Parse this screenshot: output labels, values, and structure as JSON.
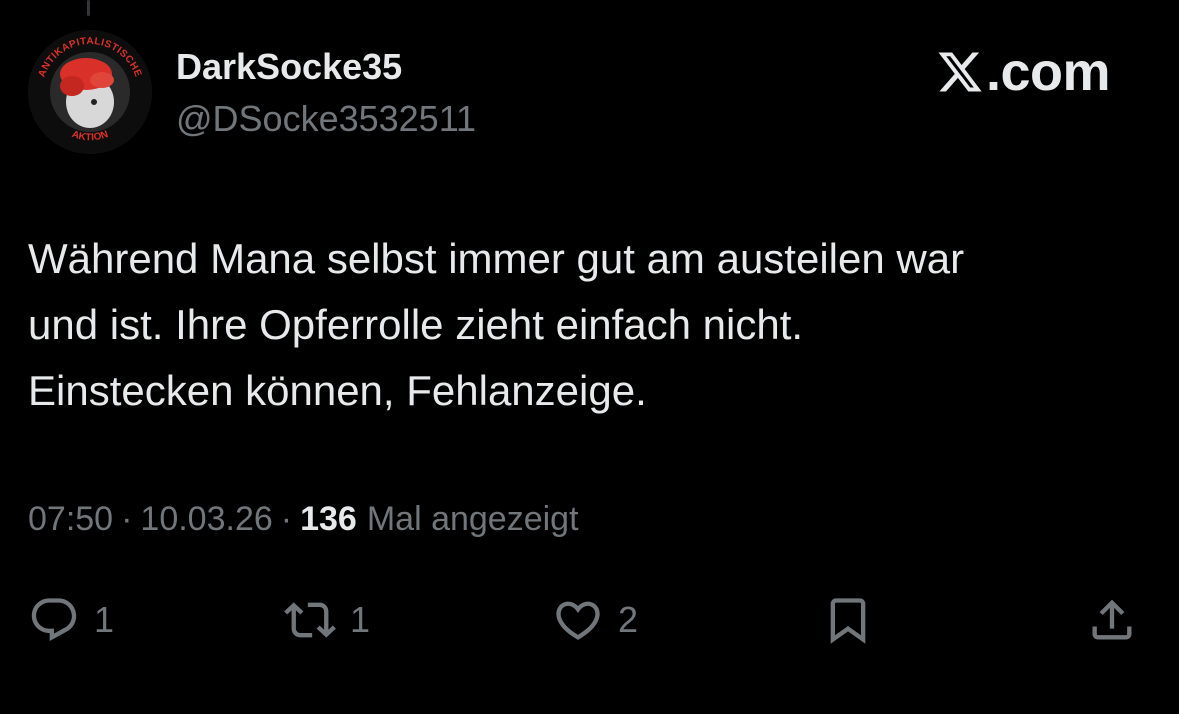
{
  "author": {
    "display_name": "DarkSocke35",
    "handle": "@DSocke3532511",
    "avatar_text_top": "ANTIKAPITALISTISCHE",
    "avatar_text_bottom": "AKTION"
  },
  "brand": {
    "label": ".com",
    "icon": "x-logo-icon"
  },
  "tweet": {
    "lines": [
      "Während Mana selbst immer gut am austeilen war",
      "und ist. Ihre Opferrolle zieht einfach nicht.",
      "Einstecken können, Fehlanzeige."
    ]
  },
  "meta": {
    "time": "07:50",
    "separator": "·",
    "date": "10.03.26",
    "views_count": "136",
    "views_label": "Mal angezeigt"
  },
  "actions": {
    "reply": {
      "icon": "reply-bubble-icon",
      "count": "1"
    },
    "repost": {
      "icon": "repost-arrows-icon",
      "count": "1"
    },
    "like": {
      "icon": "heart-icon",
      "count": "2"
    },
    "bookmark": {
      "icon": "bookmark-icon"
    },
    "share": {
      "icon": "share-upload-icon"
    }
  },
  "colors": {
    "background": "#000000",
    "text_primary": "#e7e9ea",
    "text_secondary": "#71767b",
    "avatar_accent": "#d9302a"
  }
}
